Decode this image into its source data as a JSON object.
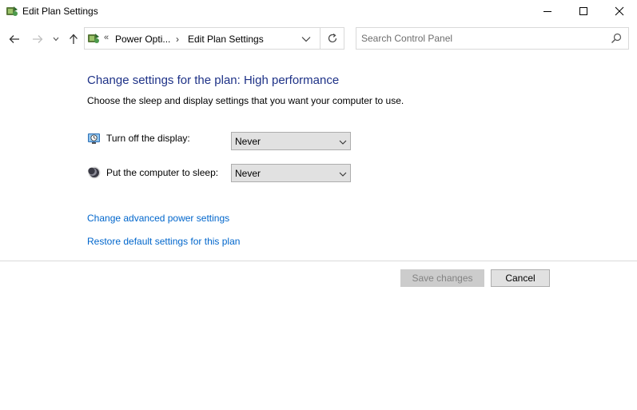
{
  "window": {
    "title": "Edit Plan Settings",
    "controls": {
      "minimize": "minimize",
      "maximize": "maximize",
      "close": "close"
    }
  },
  "nav": {
    "breadcrumb_overflow": "«",
    "breadcrumbs": [
      "Power Opti...",
      "Edit Plan Settings"
    ],
    "separator": "›"
  },
  "search": {
    "placeholder": "Search Control Panel",
    "value": ""
  },
  "main": {
    "heading": "Change settings for the plan: High performance",
    "description": "Choose the sleep and display settings that you want your computer to use.",
    "settings": [
      {
        "label": "Turn off the display:",
        "value": "Never",
        "icon": "display-timer-icon"
      },
      {
        "label": "Put the computer to sleep:",
        "value": "Never",
        "icon": "sleep-moon-icon"
      }
    ],
    "links": [
      "Change advanced power settings",
      "Restore default settings for this plan"
    ]
  },
  "footer": {
    "save_label": "Save changes",
    "save_enabled": false,
    "cancel_label": "Cancel"
  },
  "colors": {
    "heading": "#1e3287",
    "link": "#0066cc",
    "button_face": "#e1e1e1",
    "button_disabled": "#cccccc"
  }
}
